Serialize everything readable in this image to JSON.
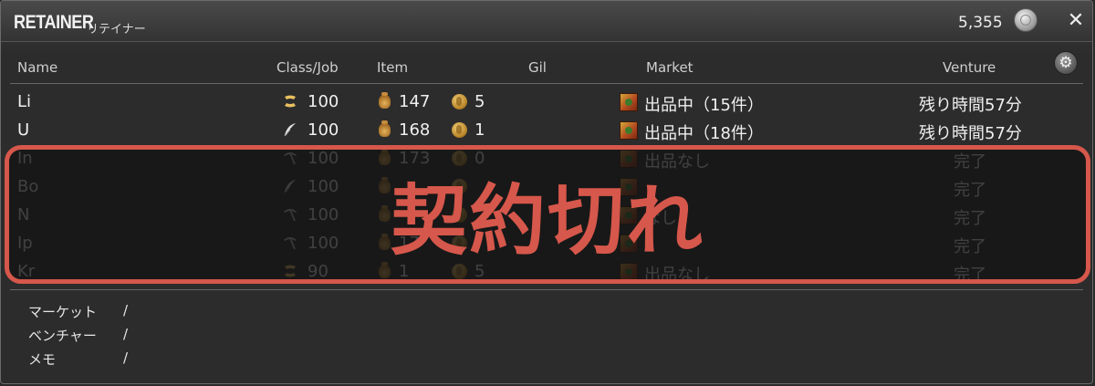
{
  "window": {
    "title": "RETAINER",
    "subtitle": "リテイナー",
    "gil_total": "5,355",
    "close_icon": "close-x-icon",
    "settings_icon": "gear-icon"
  },
  "columns": [
    "Name",
    "Class/Job",
    "Item",
    "Gil",
    "Market",
    "Venture"
  ],
  "retainers": [
    {
      "name": "Li",
      "class_icon": "axe-icon",
      "level": "100",
      "items": "147",
      "gil": "5",
      "market": "出品中（15件）",
      "venture": "残り時間57分",
      "expired": false
    },
    {
      "name": "U",
      "class_icon": "feather-icon",
      "level": "100",
      "items": "168",
      "gil": "1",
      "market": "出品中（18件）",
      "venture": "残り時間57分",
      "expired": false
    },
    {
      "name": "In",
      "class_icon": "pickaxe-icon",
      "level": "100",
      "items": "173",
      "gil": "0",
      "market": "出品なし",
      "venture": "完了",
      "expired": true
    },
    {
      "name": "Bo",
      "class_icon": "feather-icon",
      "level": "100",
      "items": "",
      "gil": "",
      "market": "",
      "venture": "完了",
      "expired": true
    },
    {
      "name": "N",
      "class_icon": "pickaxe-icon",
      "level": "100",
      "items": "",
      "gil": "",
      "market": "なし",
      "venture": "完了",
      "expired": true
    },
    {
      "name": "Ip",
      "class_icon": "pickaxe-icon",
      "level": "100",
      "items": "17",
      "gil": "",
      "market": "",
      "venture": "完了",
      "expired": true
    },
    {
      "name": "Kr",
      "class_icon": "axe-icon",
      "level": "90",
      "items": "1",
      "gil": "5",
      "market": "出品なし",
      "venture": "完了",
      "expired": true
    }
  ],
  "overlay": {
    "text": "契約切れ",
    "color": "#d6574b"
  },
  "footer": [
    {
      "label": "マーケット",
      "value": "/"
    },
    {
      "label": "ベンチャー",
      "value": "/"
    },
    {
      "label": "メモ",
      "value": "/"
    }
  ]
}
